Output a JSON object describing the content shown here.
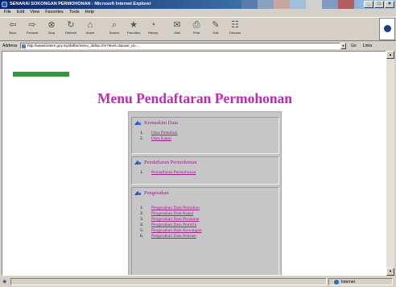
{
  "window": {
    "title": "SENARAI SOKONGAN PERMOHONAN - Microsoft Internet Explorer"
  },
  "menubar": [
    "File",
    "Edit",
    "View",
    "Favorites",
    "Tools",
    "Help"
  ],
  "toolbar": [
    {
      "label": "Back",
      "icon": "back-arrow"
    },
    {
      "label": "Forward",
      "icon": "forward-arrow"
    },
    {
      "label": "Stop",
      "icon": "stop-icon"
    },
    {
      "label": "Refresh",
      "icon": "refresh-icon"
    },
    {
      "label": "Home",
      "icon": "home-icon"
    },
    {
      "label": "Search",
      "icon": "search-icon"
    },
    {
      "label": "Favorites",
      "icon": "favorites-icon"
    },
    {
      "label": "History",
      "icon": "history-icon"
    },
    {
      "label": "Mail",
      "icon": "mail-icon"
    },
    {
      "label": "Print",
      "icon": "print-icon"
    },
    {
      "label": "Edit",
      "icon": "edit-icon"
    },
    {
      "label": "Discuss",
      "icon": "discuss-icon"
    }
  ],
  "address": {
    "label": "Address",
    "url": "http://www/sistem.gov.my/daftar/menu_daftar.cfm?level=2&user_id=...",
    "go": "Go",
    "links": "Links"
  },
  "page": {
    "badge": "",
    "title": "Menu Pendaftaran Permohonan",
    "sections": [
      {
        "title": "Kemaskini Data",
        "items": [
          {
            "num": "1.",
            "label": "Data Pemohon"
          },
          {
            "num": "2.",
            "label": "Data Kapal"
          }
        ]
      },
      {
        "title": "Pendaftaran Permohonan",
        "items": [
          {
            "num": "1.",
            "label": "Pendaftaran Permohonan"
          }
        ]
      },
      {
        "title": "Pengesahan",
        "items": [
          {
            "num": "1.",
            "label": "Pengesahan Data Pemohon"
          },
          {
            "num": "2.",
            "label": "Pengesahan Data Kapal"
          },
          {
            "num": "3.",
            "label": "Pengesahan Data Peralatan"
          },
          {
            "num": "4.",
            "label": "Pengesahan Data Pemilik"
          },
          {
            "num": "5.",
            "label": "Pengesahan Data Kewangan"
          },
          {
            "num": "6.",
            "label": "Pengesahan Data Pelesen"
          }
        ]
      }
    ]
  },
  "status": {
    "text": "",
    "zone": "Internet"
  }
}
